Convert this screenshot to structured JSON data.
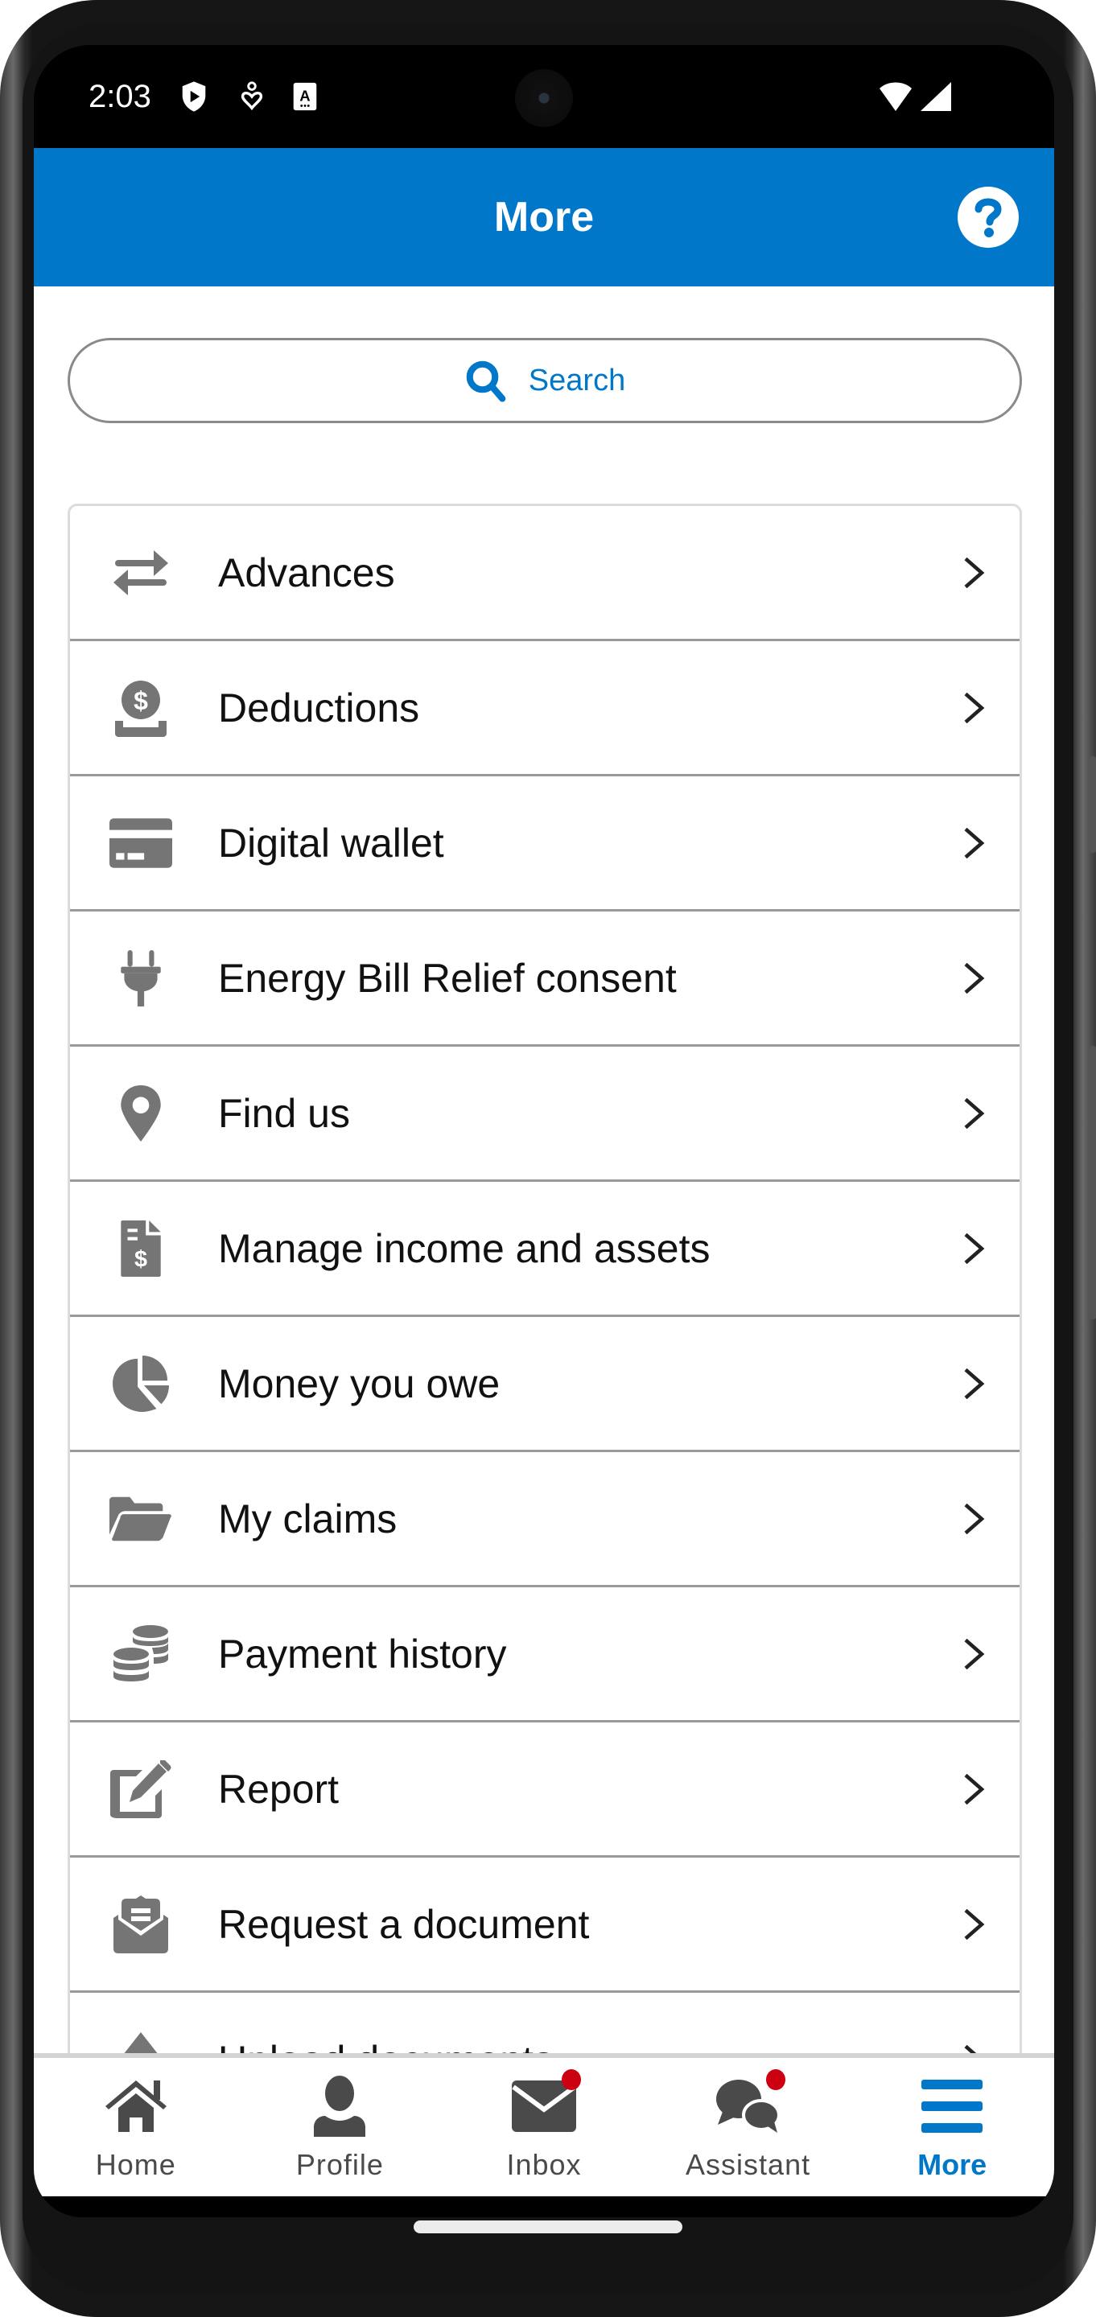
{
  "status_bar": {
    "time": "2:03",
    "left_icons": [
      "play-protect-shield-icon",
      "accessibility-heart-icon",
      "autofill-a-icon"
    ],
    "right_icons": [
      "wifi-icon",
      "cellular-signal-icon"
    ]
  },
  "header": {
    "title": "More",
    "help_icon": "help-circle-icon"
  },
  "search": {
    "placeholder": "Search",
    "icon": "search-icon"
  },
  "menu": {
    "items": [
      {
        "label": "Advances",
        "icon": "swap-arrows-icon"
      },
      {
        "label": "Deductions",
        "icon": "dollar-deposit-icon"
      },
      {
        "label": "Digital wallet",
        "icon": "credit-card-icon"
      },
      {
        "label": "Energy Bill Relief consent",
        "icon": "plug-icon"
      },
      {
        "label": "Find us",
        "icon": "location-pin-icon"
      },
      {
        "label": "Manage income and assets",
        "icon": "invoice-dollar-icon"
      },
      {
        "label": "Money you owe",
        "icon": "pie-chart-icon"
      },
      {
        "label": "My claims",
        "icon": "folder-open-icon"
      },
      {
        "label": "Payment history",
        "icon": "coins-icon"
      },
      {
        "label": "Report",
        "icon": "edit-square-icon"
      },
      {
        "label": "Request a document",
        "icon": "envelope-document-icon"
      },
      {
        "label": "Upload documents",
        "icon": "upload-arrow-icon"
      }
    ]
  },
  "bottom_nav": {
    "items": [
      {
        "label": "Home",
        "icon": "home-icon",
        "badge": false,
        "active": false
      },
      {
        "label": "Profile",
        "icon": "person-icon",
        "badge": false,
        "active": false
      },
      {
        "label": "Inbox",
        "icon": "envelope-icon",
        "badge": true,
        "active": false
      },
      {
        "label": "Assistant",
        "icon": "chat-bubbles-icon",
        "badge": true,
        "active": false
      },
      {
        "label": "More",
        "icon": "hamburger-menu-icon",
        "badge": false,
        "active": true
      }
    ]
  },
  "colors": {
    "brand_blue": "#0077c8",
    "icon_gray": "#757575",
    "nav_icon_gray": "#4a4a4a",
    "badge_red": "#cc0011"
  }
}
